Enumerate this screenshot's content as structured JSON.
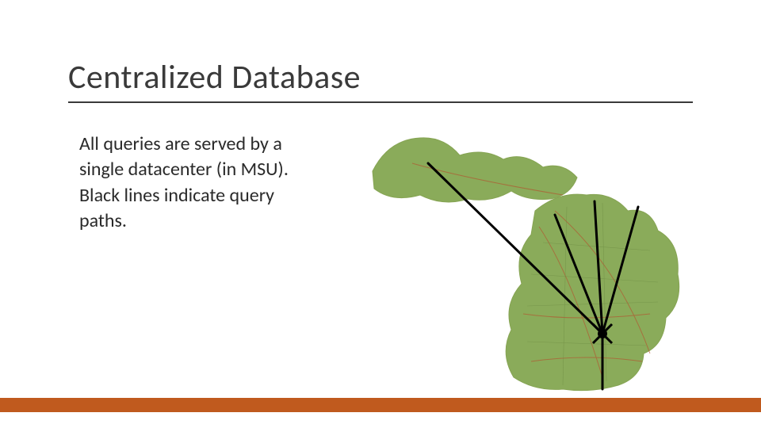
{
  "title": "Centralized Database",
  "body": "All queries are served by a single datacenter (in MSU). Black lines indicate query paths.",
  "accent_color": "#c05a1e",
  "map": {
    "region": "Michigan",
    "datacenter_label": "MSU",
    "line_meaning": "query paths"
  }
}
